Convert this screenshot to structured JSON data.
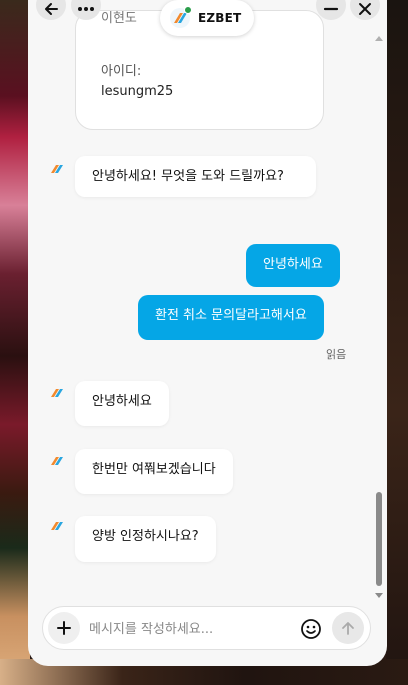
{
  "header": {
    "back_icon": "back-arrow-icon",
    "more_icon": "more-horizontal-icon",
    "brand_name": "EZBET",
    "minimize_icon": "minimize-icon",
    "close_icon": "close-icon"
  },
  "info_card": {
    "name_value": "이현도",
    "id_label": "아이디:",
    "id_value": "lesungm25"
  },
  "messages": [
    {
      "from": "bot",
      "text": "안녕하세요! 무엇을 도와 드릴까요?"
    },
    {
      "from": "user",
      "text": "안녕하세요"
    },
    {
      "from": "user",
      "text": "환전 취소 문의달라고해서요"
    },
    {
      "from": "bot",
      "text": "안녕하세요"
    },
    {
      "from": "bot",
      "text": "한번만 여쭤보겠습니다"
    },
    {
      "from": "bot",
      "text": "양방 인정하시나요?"
    }
  ],
  "read_status": "읽음",
  "composer": {
    "placeholder": "메시지를 작성하세요...",
    "attach_icon": "plus-icon",
    "emoji_icon": "smiley-icon",
    "send_icon": "send-arrow-up-icon"
  },
  "colors": {
    "user_bubble": "#05a6e6",
    "bot_bubble": "#ffffff",
    "brand_dot": "#2a9d4a"
  }
}
